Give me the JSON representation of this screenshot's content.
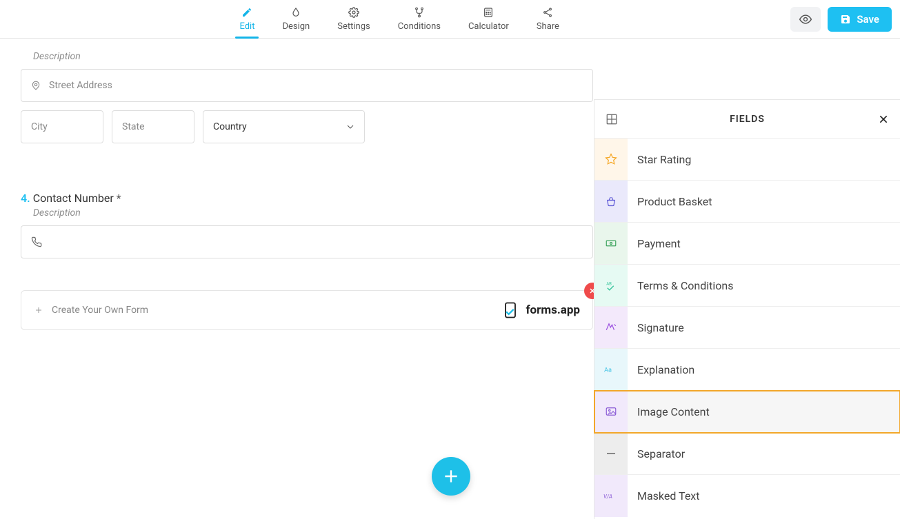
{
  "toolbar": {
    "tabs": {
      "edit": {
        "label": "Edit",
        "icon": "pencil-icon"
      },
      "design": {
        "label": "Design",
        "icon": "drop-icon"
      },
      "settings": {
        "label": "Settings",
        "icon": "gear-icon"
      },
      "conditions": {
        "label": "Conditions",
        "icon": "branch-icon"
      },
      "calculator": {
        "label": "Calculator",
        "icon": "calculator-icon"
      },
      "share": {
        "label": "Share",
        "icon": "share-icon"
      }
    },
    "active_tab": "edit",
    "save_label": "Save"
  },
  "form": {
    "address": {
      "description": "Description",
      "street_placeholder": "Street Address",
      "city_placeholder": "City",
      "state_placeholder": "State",
      "country_placeholder": "Country"
    },
    "contact": {
      "number": "4.",
      "label": "Contact Number",
      "required_mark": "*",
      "description": "Description"
    },
    "promo": {
      "text": "Create Your Own Form",
      "brand": "forms.app"
    }
  },
  "fields_panel": {
    "title": "FIELDS",
    "items": [
      {
        "icon": "star-icon",
        "tile": "star",
        "label": "Star Rating"
      },
      {
        "icon": "basket-icon",
        "tile": "basket",
        "label": "Product Basket"
      },
      {
        "icon": "payment-icon",
        "tile": "payment",
        "label": "Payment"
      },
      {
        "icon": "terms-icon",
        "tile": "terms",
        "label": "Terms & Conditions"
      },
      {
        "icon": "signature-icon",
        "tile": "signature",
        "label": "Signature"
      },
      {
        "icon": "explain-icon",
        "tile": "explain",
        "label": "Explanation"
      },
      {
        "icon": "image-icon",
        "tile": "image",
        "label": "Image Content",
        "highlight": true
      },
      {
        "icon": "separator-icon",
        "tile": "sep",
        "label": "Separator"
      },
      {
        "icon": "masked-icon",
        "tile": "masked",
        "label": "Masked Text"
      }
    ]
  }
}
